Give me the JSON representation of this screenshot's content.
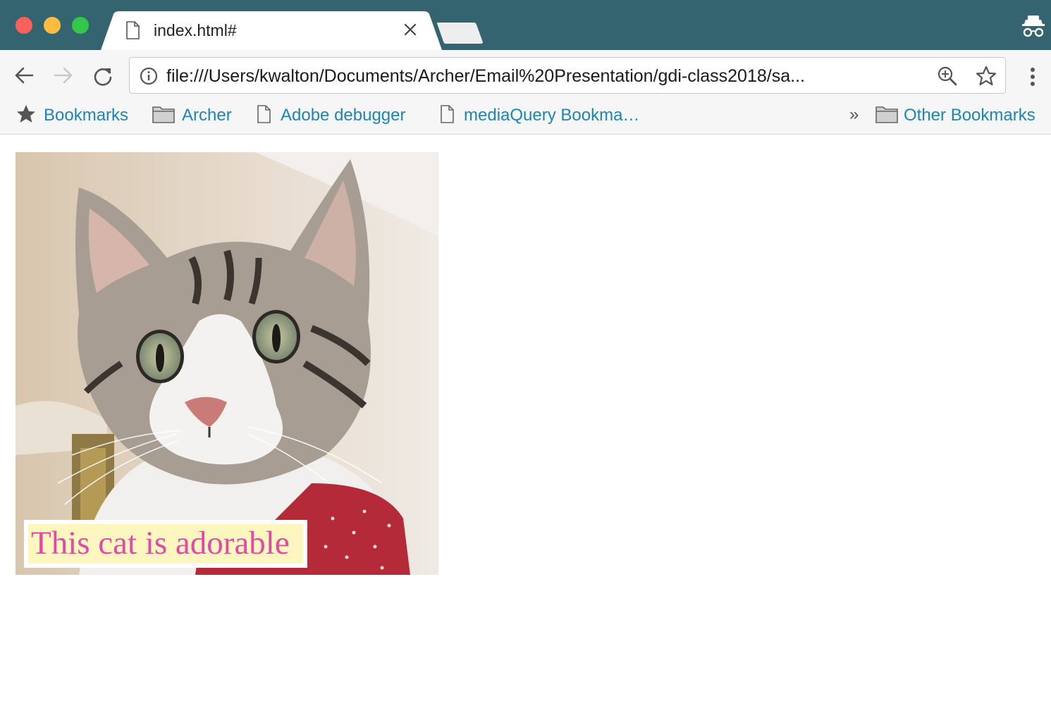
{
  "window": {
    "controls": [
      "close",
      "minimize",
      "zoom"
    ],
    "colors": {
      "titlebar": "#33646f",
      "close": "#fc605c",
      "minimize": "#fdbc40",
      "zoom": "#34c84a"
    }
  },
  "tab": {
    "title": "index.html#",
    "icon": "file-icon",
    "close_icon": "close-icon"
  },
  "toolbar": {
    "back_icon": "back-arrow-icon",
    "forward_icon": "forward-arrow-icon",
    "reload_icon": "reload-icon",
    "url": "file:///Users/kwalton/Documents/Archer/Email%20Presentation/gdi-class2018/sa...",
    "zoom_icon": "zoom-in-icon",
    "star_icon": "star-icon",
    "menu_icon": "kebab-menu-icon",
    "profile_icon": "incognito-icon"
  },
  "bookmarks": {
    "items": [
      {
        "label": "Bookmarks",
        "icon": "star-icon"
      },
      {
        "label": "Archer",
        "icon": "folder-icon"
      },
      {
        "label": "Adobe debugger",
        "icon": "page-icon"
      },
      {
        "label": "mediaQuery Bookma…",
        "icon": "page-icon"
      }
    ],
    "overflow": "»",
    "other": {
      "label": "Other Bookmarks",
      "icon": "folder-icon"
    }
  },
  "content": {
    "image_subject": "tabby cat with red polka-dot bow tie",
    "caption": "This cat is adorable",
    "colors": {
      "caption_text": "#e04aa9",
      "caption_bg": "#fdf6bf"
    }
  }
}
